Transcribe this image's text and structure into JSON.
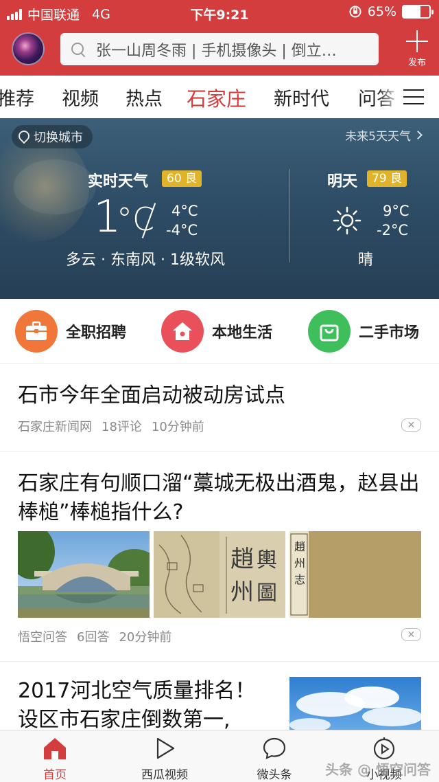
{
  "status_bar": {
    "carrier": "中国联通",
    "network": "4G",
    "time": "下午9:21",
    "battery": "65%",
    "battery_level": 0.65
  },
  "header": {
    "search_text": "张一山周冬雨 | 手机摄像头 | 倒立…",
    "publish_label": "发布"
  },
  "channel_tabs": [
    "推荐",
    "视频",
    "热点",
    "石家庄",
    "新时代",
    "问答"
  ],
  "active_channel": "石家庄",
  "weather": {
    "switch_city": "切换城市",
    "forecast_link": "未来5天天气",
    "now": {
      "title": "实时天气",
      "aqi": "60 良",
      "temp": "1",
      "unit": "°C",
      "high": "4°C",
      "low": "-4°C",
      "desc": "多云 · 东南风 · 1级软风"
    },
    "tomorrow": {
      "title": "明天",
      "aqi": "79 良",
      "high": "9°C",
      "low": "-2°C",
      "desc": "晴"
    },
    "colors": {
      "aqi_badge": "#e1b32b"
    }
  },
  "services": [
    {
      "label": "全职招聘",
      "color": "#f0763a",
      "icon": "briefcase-icon"
    },
    {
      "label": "本地生活",
      "color": "#e9505a",
      "icon": "home-icon"
    },
    {
      "label": "二手市场",
      "color": "#3fbf5c",
      "icon": "shopping-bag-icon"
    }
  ],
  "articles": [
    {
      "title": "石市今年全面启动被动房试点",
      "source": "石家庄新闻网",
      "comments": "18评论",
      "time": "10分钟前"
    },
    {
      "title": "石家庄有句顺口溜“藁城无极出酒鬼，赵县出棒槌”棒槌指什么?",
      "source": "悟空问答",
      "comments": "6回答",
      "time": "20分钟前",
      "image_watermark": "悟空问答"
    },
    {
      "title": "2017河北空气质量排名！设区市石家庄倒数第一,"
    }
  ],
  "bottom_tabs": [
    {
      "label": "首页",
      "icon": "home-icon"
    },
    {
      "label": "西瓜视频",
      "icon": "play-icon"
    },
    {
      "label": "微头条",
      "icon": "chat-bubble-icon"
    },
    {
      "label": "小视频",
      "icon": "short-video-icon"
    }
  ],
  "active_bottom_tab": "首页",
  "watermark": "头条 @ 悟空问答",
  "colors": {
    "brand_red": "#d43d3d",
    "active_tab": "#d43d3d"
  }
}
